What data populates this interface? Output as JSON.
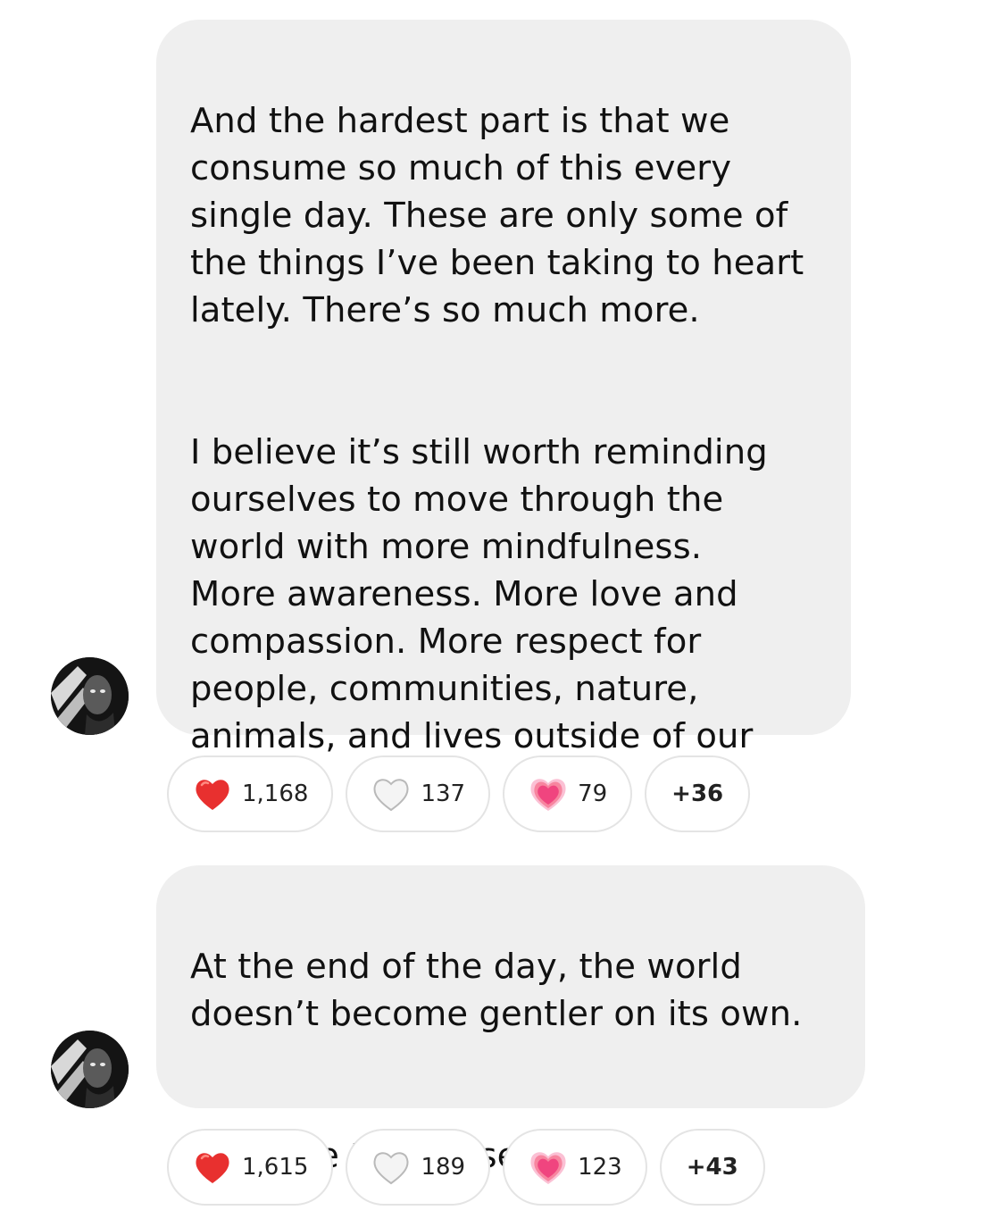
{
  "messages": [
    {
      "paragraphs": [
        "And the hardest part is that we\nconsume so much of this every\nsingle day. These are only some of\nthe things I’ve been taking to heart\nlately. There’s so much more.",
        "I believe it’s still worth reminding\nourselves to move through the\nworld with more mindfulness.\nMore awareness. More love and\ncompassion. More respect for\npeople, communities, nature,\nanimals, and lives outside of our\nown."
      ],
      "reactions": [
        {
          "emoji": "red-heart-icon",
          "count": "1,168"
        },
        {
          "emoji": "white-heart-icon",
          "count": "137"
        },
        {
          "emoji": "growing-heart-icon",
          "count": "79"
        }
      ],
      "more": "+36"
    },
    {
      "paragraphs": [
        "At the end of the day, the world\ndoesn’t become gentler on its own.",
        "We have to choose it."
      ],
      "reactions": [
        {
          "emoji": "red-heart-icon",
          "count": "1,615"
        },
        {
          "emoji": "white-heart-icon",
          "count": "189"
        },
        {
          "emoji": "growing-heart-icon",
          "count": "123"
        }
      ],
      "more": "+43"
    }
  ],
  "colors": {
    "bubble": "#efefef",
    "heart_red": "#e8302f",
    "heart_pink": "#f0457f"
  }
}
